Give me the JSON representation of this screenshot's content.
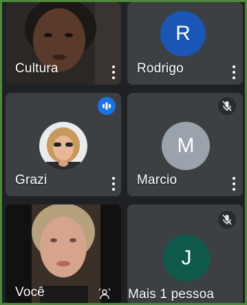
{
  "colors": {
    "frame": "#4f8a3c",
    "background": "#202124",
    "tile": "#3c4043",
    "rodrigo_avatar": "#1a56b5",
    "marcio_avatar": "#9aa3ab",
    "j_avatar": "#0f5a4a",
    "speaking": "#1a73e8"
  },
  "participants": [
    {
      "name": "Cultura",
      "type": "video"
    },
    {
      "name": "Rodrigo",
      "type": "avatar",
      "initial": "R"
    },
    {
      "name": "Grazi",
      "type": "photo",
      "indicator": "speaking"
    },
    {
      "name": "Marcio",
      "type": "avatar",
      "initial": "M",
      "indicator": "muted"
    },
    {
      "name": "Você",
      "type": "video",
      "indicator": "pin"
    },
    {
      "name": "Mais 1 pessoa",
      "type": "avatar",
      "initial": "J",
      "indicator": "muted"
    }
  ]
}
